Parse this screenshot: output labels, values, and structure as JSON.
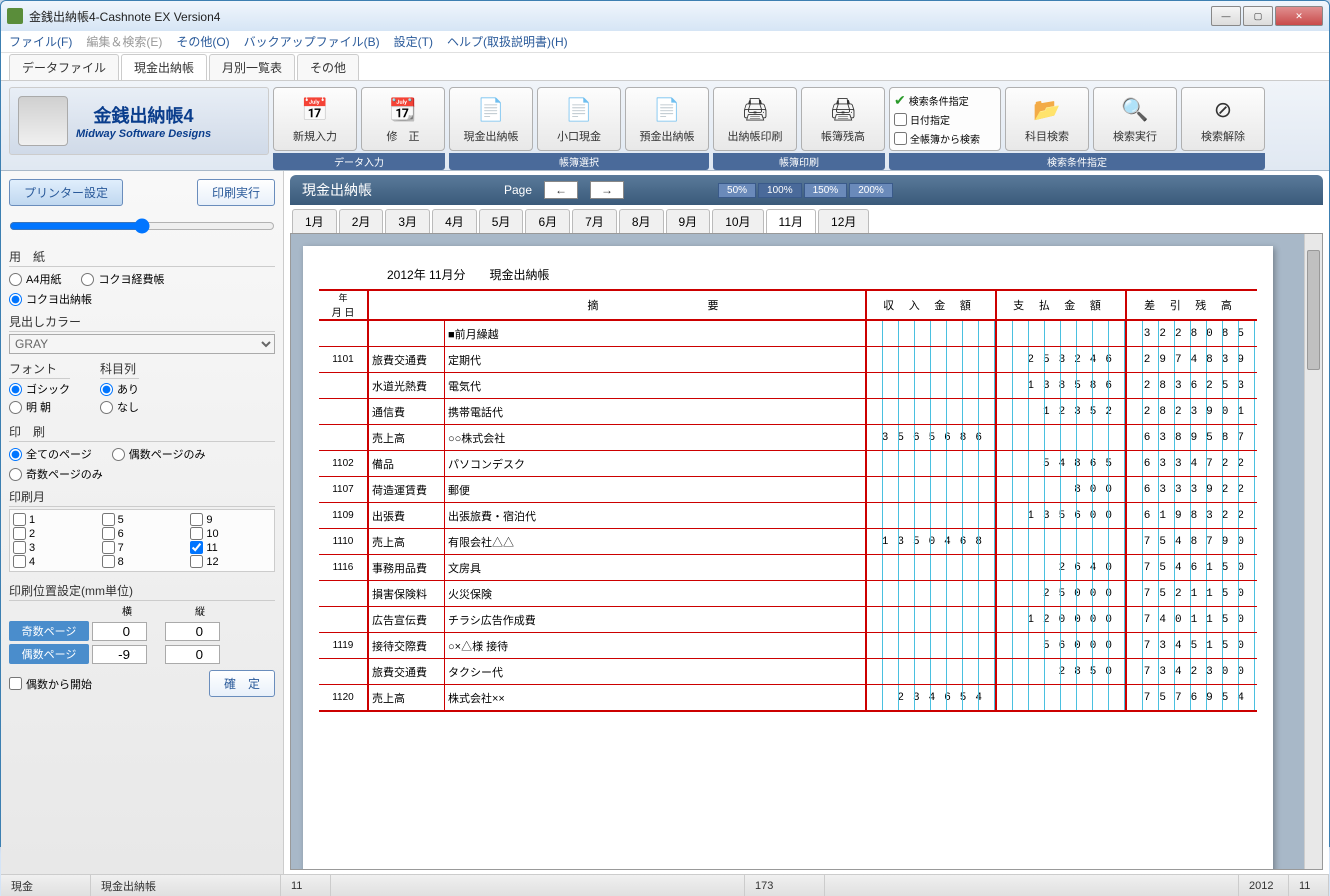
{
  "window": {
    "title": "金銭出納帳4-Cashnote EX Version4"
  },
  "menubar": [
    "ファイル(F)",
    "編集＆検索(E)",
    "その他(O)",
    "バックアップファイル(B)",
    "設定(T)",
    "ヘルプ(取扱説明書)(H)"
  ],
  "maintabs": [
    "データファイル",
    "現金出納帳",
    "月別一覧表",
    "その他"
  ],
  "active_maintab": 1,
  "logo": {
    "jp": "金銭出納帳4",
    "en": "Midway Software Designs"
  },
  "toolbar": {
    "g1_label": "データ入力",
    "g1": [
      {
        "label": "新規入力",
        "icon": "📅"
      },
      {
        "label": "修　正",
        "icon": "📆"
      }
    ],
    "g2_label": "帳簿選択",
    "g2": [
      {
        "label": "現金出納帳",
        "icon": "📄"
      },
      {
        "label": "小口現金",
        "icon": "📄"
      },
      {
        "label": "預金出納帳",
        "icon": "📄"
      }
    ],
    "g3_label": "帳簿印刷",
    "g3": [
      {
        "label": "出納帳印刷",
        "icon": "🖨"
      },
      {
        "label": "帳簿残高",
        "icon": "🖨"
      }
    ],
    "g4_label": "検索条件指定",
    "search": {
      "header": "検索条件指定",
      "opt1": "日付指定",
      "opt2": "全帳簿から検索"
    },
    "g4": [
      {
        "label": "科目検索",
        "icon": "📂"
      },
      {
        "label": "検索実行",
        "icon": "🔍"
      },
      {
        "label": "検索解除",
        "icon": "⊘"
      }
    ]
  },
  "sidebar": {
    "printer_settings": "プリンター設定",
    "print_run": "印刷実行",
    "paper_title": "用　紙",
    "paper_opts": [
      "A4用紙",
      "コクヨ経費帳",
      "コクヨ出納帳"
    ],
    "paper_selected": "コクヨ出納帳",
    "heading_color_title": "見出しカラー",
    "heading_color_value": "GRAY",
    "font_title": "フォント",
    "font_opts": [
      "ゴシック",
      "明 朝"
    ],
    "font_selected": "ゴシック",
    "subject_title": "科目列",
    "subject_opts": [
      "あり",
      "なし"
    ],
    "subject_selected": "あり",
    "print_title": "印　刷",
    "print_opts": [
      "全てのページ",
      "偶数ページのみ",
      "奇数ページのみ"
    ],
    "print_selected": "全てのページ",
    "month_title": "印刷月",
    "months": [
      [
        "1",
        false
      ],
      [
        "5",
        false
      ],
      [
        "9",
        false
      ],
      [
        "2",
        false
      ],
      [
        "6",
        false
      ],
      [
        "10",
        false
      ],
      [
        "3",
        false
      ],
      [
        "7",
        false
      ],
      [
        "11",
        true
      ],
      [
        "4",
        false
      ],
      [
        "8",
        false
      ],
      [
        "12",
        false
      ]
    ],
    "pos_title": "印刷位置設定(mm単位)",
    "pos_h": "横",
    "pos_v": "縦",
    "odd_label": "奇数ページ",
    "even_label": "偶数ページ",
    "odd_h": "0",
    "odd_v": "0",
    "even_h": "-9",
    "even_v": "0",
    "even_start": "偶数から開始",
    "confirm": "確　定"
  },
  "mainheader": {
    "title": "現金出納帳",
    "page_label": "Page",
    "prev": "←",
    "next": "→",
    "zoom": [
      "50%",
      "100%",
      "150%",
      "200%"
    ],
    "zoom_active": 1
  },
  "monthtabs": [
    "1月",
    "2月",
    "3月",
    "4月",
    "5月",
    "6月",
    "7月",
    "8月",
    "9月",
    "10月",
    "11月",
    "12月"
  ],
  "active_monthtab": 10,
  "ledger": {
    "title": "2012年 11月分　　現金出納帳",
    "header": {
      "date_y": "年",
      "date_md": "月 日",
      "summary": "摘　　　　　　　要",
      "income": "収 入 金 額",
      "expense": "支 払 金 額",
      "balance": "差 引 残 高"
    },
    "rows": [
      {
        "md": "",
        "cat": "",
        "desc": "■前月繰越",
        "in": "",
        "out": "",
        "bal": "3228085"
      },
      {
        "md": "1101",
        "cat": "旅費交通費",
        "desc": "定期代",
        "in": "",
        "out": "253246",
        "bal": "2974839"
      },
      {
        "md": "",
        "cat": "水道光熱費",
        "desc": "電気代",
        "in": "",
        "out": "138586",
        "bal": "2836253"
      },
      {
        "md": "",
        "cat": "通信費",
        "desc": "携帯電話代",
        "in": "",
        "out": "12352",
        "bal": "2823901"
      },
      {
        "md": "",
        "cat": "売上高",
        "desc": "○○株式会社",
        "in": "3565686",
        "out": "",
        "bal": "6389587"
      },
      {
        "md": "1102",
        "cat": "備品",
        "desc": "パソコンデスク",
        "in": "",
        "out": "54865",
        "bal": "6334722"
      },
      {
        "md": "1107",
        "cat": "荷造運賃費",
        "desc": "郵便",
        "in": "",
        "out": "800",
        "bal": "6333922"
      },
      {
        "md": "1109",
        "cat": "出張費",
        "desc": "出張旅費・宿泊代",
        "in": "",
        "out": "135600",
        "bal": "6198322"
      },
      {
        "md": "1110",
        "cat": "売上高",
        "desc": "有限会社△△",
        "in": "1350468",
        "out": "",
        "bal": "7548790"
      },
      {
        "md": "1116",
        "cat": "事務用品費",
        "desc": "文房具",
        "in": "",
        "out": "2640",
        "bal": "7546150"
      },
      {
        "md": "",
        "cat": "損害保険料",
        "desc": "火災保険",
        "in": "",
        "out": "25000",
        "bal": "7521150"
      },
      {
        "md": "",
        "cat": "広告宣伝費",
        "desc": "チラシ広告作成費",
        "in": "",
        "out": "120000",
        "bal": "7401150"
      },
      {
        "md": "1119",
        "cat": "接待交際費",
        "desc": "○×△様 接待",
        "in": "",
        "out": "56000",
        "bal": "7345150"
      },
      {
        "md": "",
        "cat": "旅費交通費",
        "desc": "タクシー代",
        "in": "",
        "out": "2850",
        "bal": "7342300"
      },
      {
        "md": "1120",
        "cat": "売上高",
        "desc": "株式会社××",
        "in": "234654",
        "out": "",
        "bal": "7576954"
      }
    ]
  },
  "statusbar": {
    "s1": "現金",
    "s2": "現金出納帳",
    "s3": "11",
    "s4": "173",
    "s5": "2012",
    "s6": "11"
  }
}
